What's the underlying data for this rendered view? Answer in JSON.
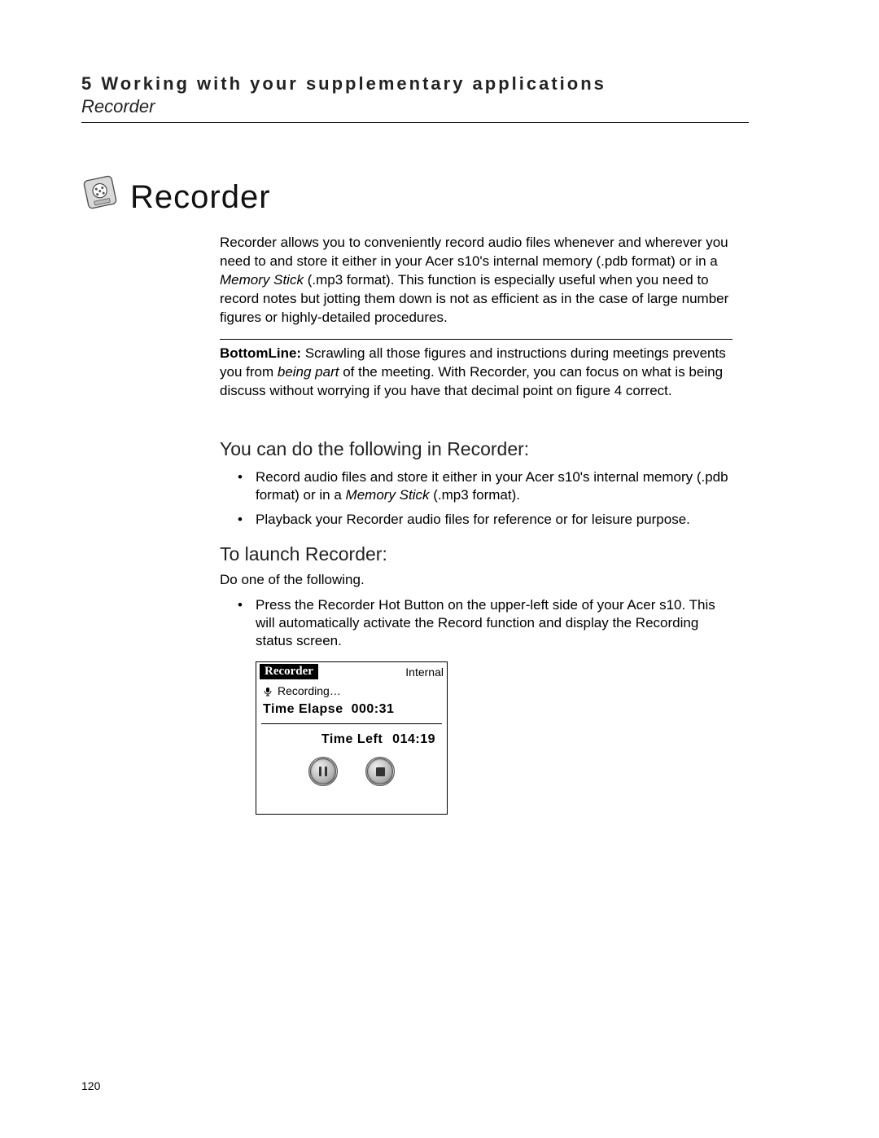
{
  "runhead": {
    "chapter": "5 Working with your supplementary applications",
    "section": "Recorder"
  },
  "title": "Recorder",
  "intro": {
    "p1a": "Recorder allows you to conveniently record audio files whenever and wherever you need to and store it either in your Acer s10's internal memory (.pdb format) or in a ",
    "p1_ital": "Memory Stick",
    "p1b": " (.mp3 format). This function is especially useful when you need to record notes but jotting them down is not as efficient as in the case of large number figures or highly-detailed procedures."
  },
  "bottomline": {
    "label": "BottomLine:",
    "t1": " Scrawling all those figures and instructions during meetings prevents you from ",
    "ital": "being part",
    "t2": " of the meeting. With Recorder, you can focus on what is being discuss without worrying if you have that decimal point on figure 4 correct."
  },
  "can_do": {
    "heading": "You can do the following in Recorder:",
    "item1a": "Record audio files and store it either in your Acer s10's internal memory (.pdb format) or in a ",
    "item1_ital": "Memory Stick",
    "item1b": " (.mp3 format).",
    "item2": "Playback your Recorder audio files for reference or for leisure purpose."
  },
  "launch": {
    "heading": "To launch Recorder:",
    "lead": "Do one of the following.",
    "item1": "Press the Recorder Hot Button on the upper-left side of your Acer s10. This will automatically activate the Record function and display the Recording status screen."
  },
  "device": {
    "title": "Recorder",
    "mode": "Internal",
    "status": "Recording…",
    "elapse_label": "Time Elapse",
    "elapse_value": "000:31",
    "left_label": "Time Left",
    "left_value": "014:19"
  },
  "page_number": "120"
}
